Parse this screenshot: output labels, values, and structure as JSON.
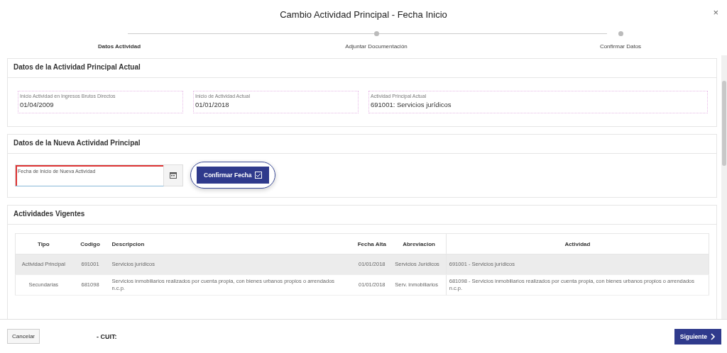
{
  "dialog": {
    "title": "Cambio Actividad Principal - Fecha Inicio",
    "close": "×"
  },
  "steps": [
    {
      "label": "Datos Actividad",
      "selected": true
    },
    {
      "label": "Adjuntar Documentación",
      "selected": false
    },
    {
      "label": "Confirmar Datos",
      "selected": false
    }
  ],
  "current_section": {
    "title": "Datos de la Actividad Principal Actual",
    "fields": [
      {
        "label": "Inicio Actividad en Ingresos Brutos Directos",
        "value": "01/04/2009"
      },
      {
        "label": "Inicio de Actividad Actual",
        "value": "01/01/2018"
      },
      {
        "label": "Actividad Principal Actual",
        "value": "691001: Servicios jurídicos"
      }
    ]
  },
  "new_section": {
    "title": "Datos de la Nueva Actividad Principal",
    "date_field": {
      "placeholder": "Fecha de Inicio de Nueva Actividad",
      "required": true
    },
    "confirm_button": "Confirmar Fecha"
  },
  "activities_section": {
    "title": "Actividades Vigentes",
    "table": {
      "columns": [
        "Tipo",
        "Codigo",
        "Descripcion",
        "Fecha Alta",
        "Abreviacion",
        "Actividad"
      ],
      "rows": [
        {
          "cells": [
            "Actividad Principal",
            "691001",
            "Servicios jurídicos",
            "01/01/2018",
            "Servicios Jurídicos",
            "691001 - Servicios jurídicos"
          ]
        },
        {
          "cells": [
            "Secundarias",
            "681098",
            "Servicios inmobiliarios realizados por cuenta propia, con bienes urbanos propios o arrendados n.c.p.",
            "01/01/2018",
            "Serv. inmobiliarios",
            "681098 - Servicios inmobiliarios realizados por cuenta propia, con bienes urbanos propios o arrendados n.c.p."
          ]
        }
      ]
    }
  },
  "footer": {
    "cancel": "Cancelar",
    "cuit_label": "- CUIT:",
    "next": "Siguiente"
  }
}
